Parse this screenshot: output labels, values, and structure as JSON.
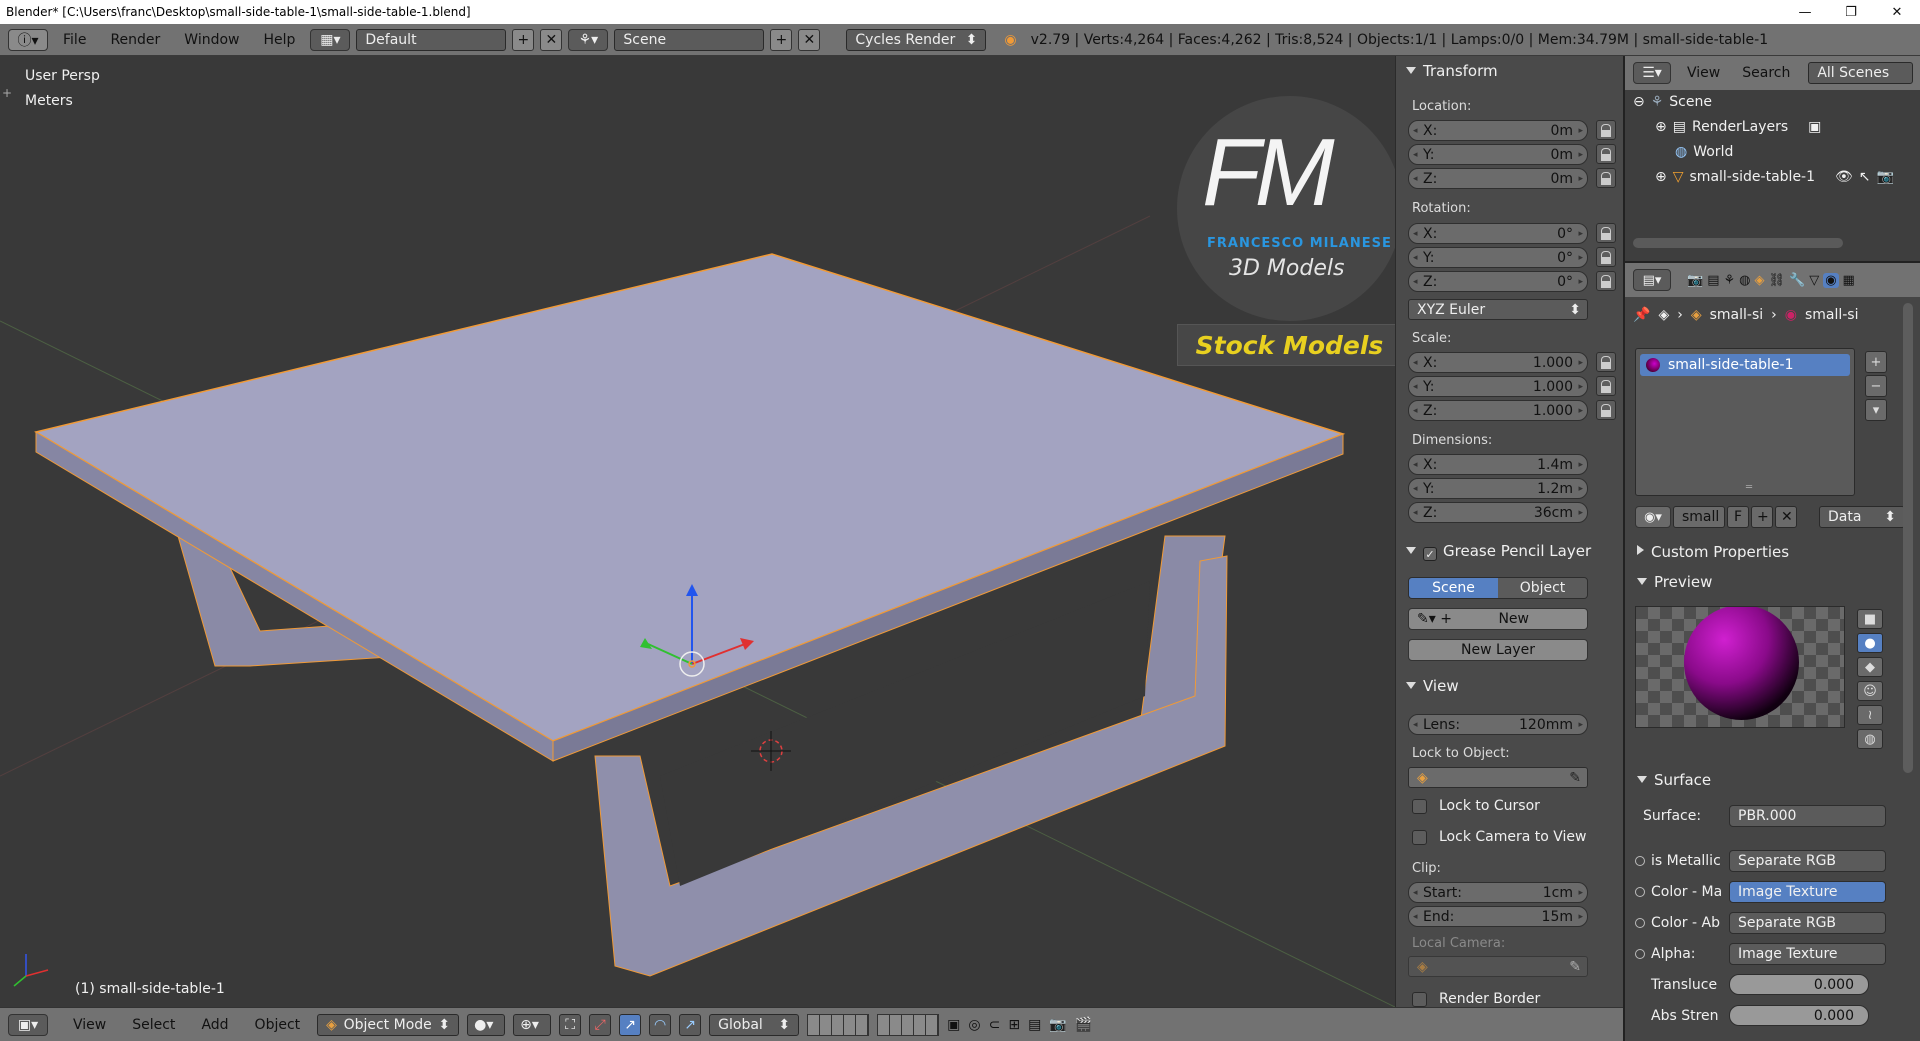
{
  "window": {
    "title": "Blender* [C:\\Users\\franc\\Desktop\\small-side-table-1\\small-side-table-1.blend]",
    "controls": [
      "—",
      "❐",
      "✕"
    ]
  },
  "topbar": {
    "menus": [
      "File",
      "Render",
      "Window",
      "Help"
    ],
    "layout": "Default",
    "scene": "Scene",
    "engine": "Cycles Render",
    "stats": "v2.79 | Verts:4,264 | Faces:4,262 | Tris:8,524 | Objects:1/1 | Lamps:0/0 | Mem:34.79M | small-side-table-1"
  },
  "viewport": {
    "view_name": "User Persp",
    "units": "Meters",
    "object_label": "(1) small-side-table-1",
    "logo_initials": "FM",
    "logo_name": "FRANCESCO MILANESE",
    "logo_sub": "3D Models",
    "banner": "Stock Models"
  },
  "transform": {
    "header": "Transform",
    "location_label": "Location:",
    "location": [
      {
        "k": "X:",
        "v": "0m"
      },
      {
        "k": "Y:",
        "v": "0m"
      },
      {
        "k": "Z:",
        "v": "0m"
      }
    ],
    "rotation_label": "Rotation:",
    "rotation": [
      {
        "k": "X:",
        "v": "0°"
      },
      {
        "k": "Y:",
        "v": "0°"
      },
      {
        "k": "Z:",
        "v": "0°"
      }
    ],
    "rotation_mode": "XYZ Euler",
    "scale_label": "Scale:",
    "scale": [
      {
        "k": "X:",
        "v": "1.000"
      },
      {
        "k": "Y:",
        "v": "1.000"
      },
      {
        "k": "Z:",
        "v": "1.000"
      }
    ],
    "dimensions_label": "Dimensions:",
    "dimensions": [
      {
        "k": "X:",
        "v": "1.4m"
      },
      {
        "k": "Y:",
        "v": "1.2m"
      },
      {
        "k": "Z:",
        "v": "36cm"
      }
    ]
  },
  "grease": {
    "header": "Grease Pencil Layer",
    "tab_scene": "Scene",
    "tab_object": "Object",
    "new": "New",
    "new_layer": "New Layer"
  },
  "view": {
    "header": "View",
    "lens_k": "Lens:",
    "lens_v": "120mm",
    "lock_object": "Lock to Object:",
    "lock_cursor": "Lock to Cursor",
    "lock_camera": "Lock Camera to View",
    "clip": "Clip:",
    "start_k": "Start:",
    "start_v": "1cm",
    "end_k": "End:",
    "end_v": "15m",
    "local_camera": "Local Camera:",
    "render_border": "Render Border"
  },
  "outliner": {
    "view": "View",
    "search": "Search",
    "filter": "All Scenes",
    "rows": [
      "Scene",
      "RenderLayers",
      "World",
      "small-side-table-1"
    ]
  },
  "material": {
    "crumb1": "small-si",
    "crumb2": "small-si",
    "slot": "small-side-table-1",
    "id_name": "small",
    "fake_user": "F",
    "link": "Data",
    "custom_props": "Custom Properties",
    "preview": "Preview",
    "surface_header": "Surface",
    "surface_k": "Surface:",
    "surface_v": "PBR.000",
    "rows": [
      {
        "k": "is Metallic",
        "v": "Separate RGB"
      },
      {
        "k": "Color - Ma",
        "v": "Image Texture"
      },
      {
        "k": "Color - Ab",
        "v": "Separate RGB"
      },
      {
        "k": "Alpha:",
        "v": "Image Texture"
      }
    ],
    "translucent_k": "Transluce",
    "translucent_v": "0.000",
    "abs_k": "Abs Stren",
    "abs_v": "0.000"
  },
  "bottombar": {
    "menus": [
      "View",
      "Select",
      "Add",
      "Object"
    ],
    "mode": "Object Mode",
    "orientation": "Global"
  },
  "colors": {
    "accent": "#5680c2",
    "selection": "#f09a37",
    "bg": "#393939"
  }
}
